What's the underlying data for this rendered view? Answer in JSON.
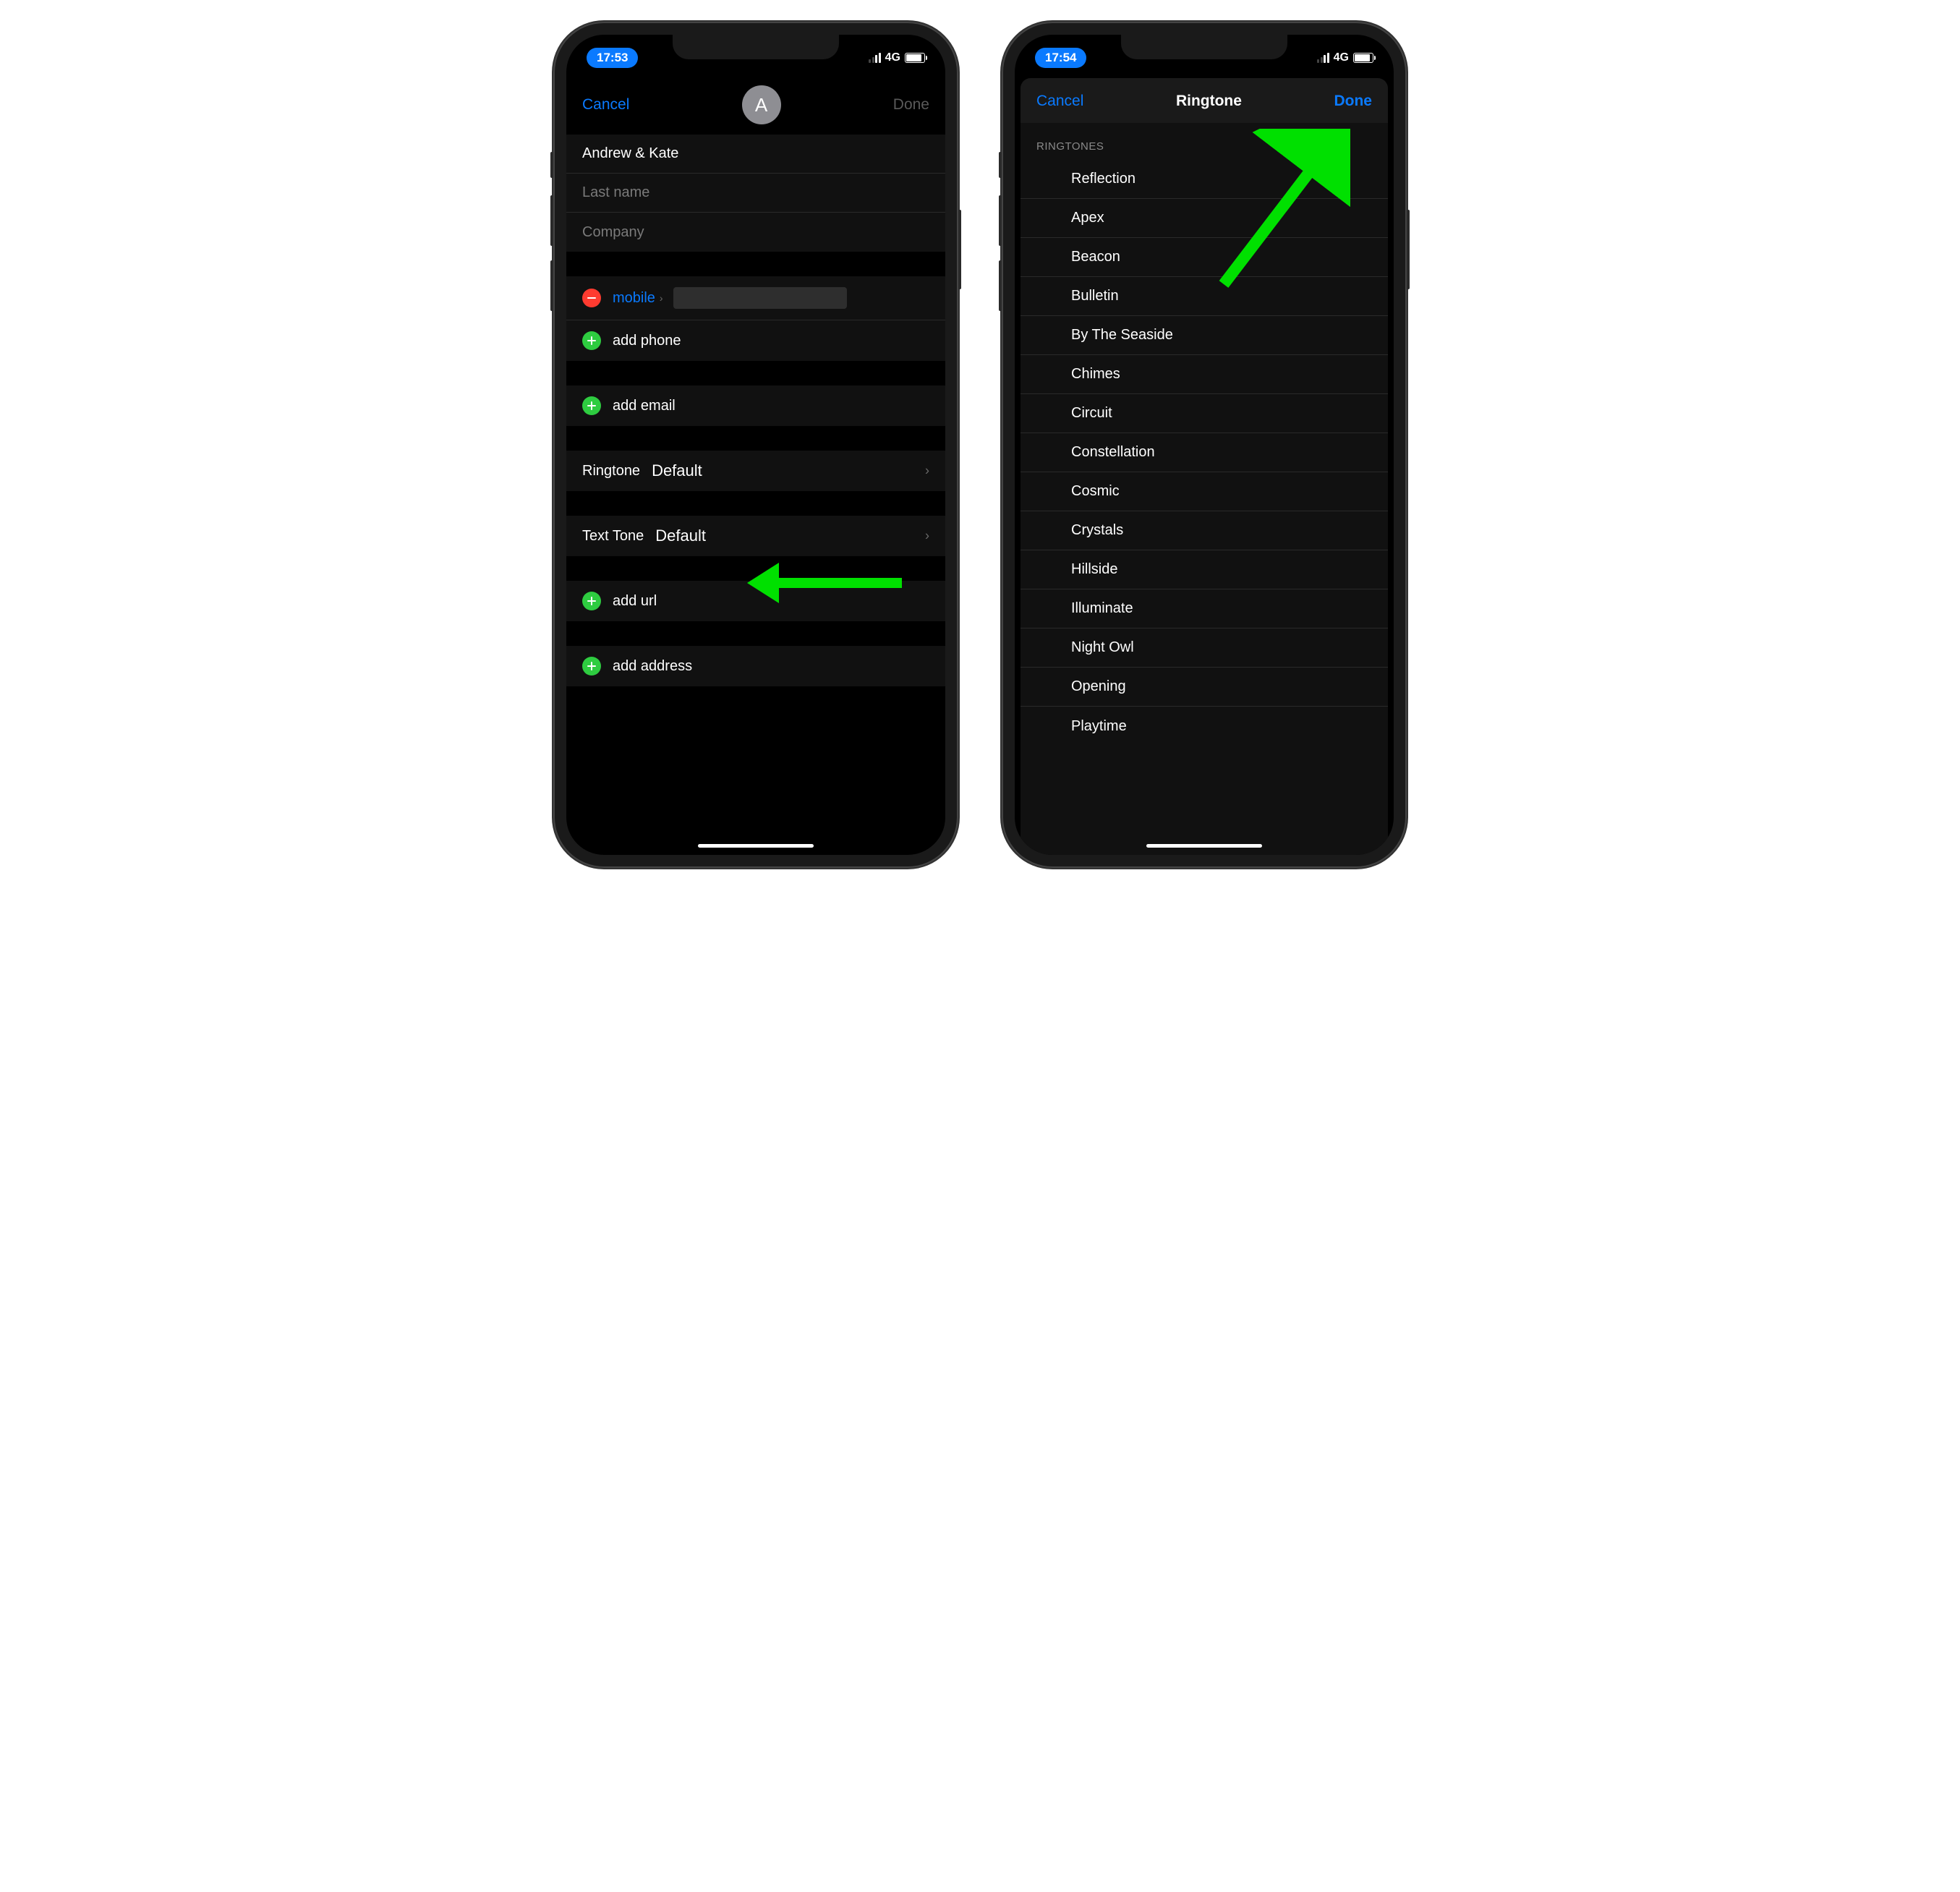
{
  "left": {
    "status": {
      "time": "17:53",
      "network": "4G"
    },
    "nav": {
      "cancel": "Cancel",
      "done": "Done",
      "avatar_letter": "A"
    },
    "fields": {
      "first_name_value": "Andrew & Kate",
      "last_name_placeholder": "Last name",
      "company_placeholder": "Company"
    },
    "phone": {
      "type_label": "mobile",
      "add_phone": "add phone"
    },
    "email": {
      "add_email": "add email"
    },
    "ringtone": {
      "label": "Ringtone",
      "value": "Default"
    },
    "texttone": {
      "label": "Text Tone",
      "value": "Default"
    },
    "url": {
      "add_url": "add url"
    },
    "address": {
      "add_address": "add address"
    }
  },
  "right": {
    "status": {
      "time": "17:54",
      "network": "4G"
    },
    "nav": {
      "cancel": "Cancel",
      "title": "Ringtone",
      "done": "Done"
    },
    "header": "RINGTONES",
    "items": [
      "Reflection",
      "Apex",
      "Beacon",
      "Bulletin",
      "By The Seaside",
      "Chimes",
      "Circuit",
      "Constellation",
      "Cosmic",
      "Crystals",
      "Hillside",
      "Illuminate",
      "Night Owl",
      "Opening",
      "Playtime"
    ]
  }
}
